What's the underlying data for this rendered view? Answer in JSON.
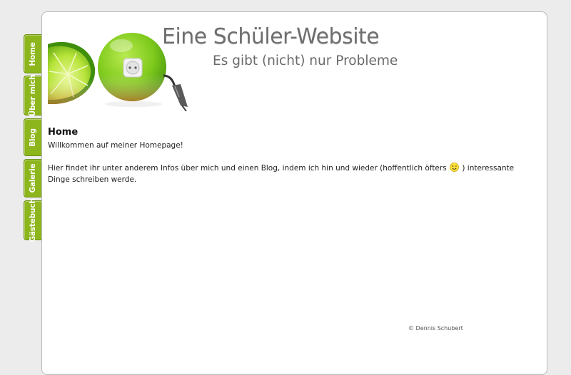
{
  "site": {
    "title": "Eine Schüler-Website",
    "subtitle": "Es gibt (nicht) nur Probleme"
  },
  "nav": {
    "tabs": [
      {
        "label": "Home"
      },
      {
        "label": "Über mich"
      },
      {
        "label": "Blog"
      },
      {
        "label": "Galerie"
      },
      {
        "label": "Gästebuch"
      }
    ]
  },
  "content": {
    "heading": "Home",
    "welcome": "Willkommen auf meiner Homepage!",
    "intro_before": "Hier findet ihr unter anderem Infos über mich und einen Blog, indem ich hin und wieder (hoffentlich öfters",
    "intro_after": ") interessante Dinge schreiben werde."
  },
  "footer": {
    "copyright": "© Dennis Schubert"
  },
  "colors": {
    "tab_green": "#8db61c",
    "page_background": "#ececec"
  },
  "icons": {
    "header_image": "lime-with-power-socket",
    "emoticon": "wink-smiley-icon"
  }
}
